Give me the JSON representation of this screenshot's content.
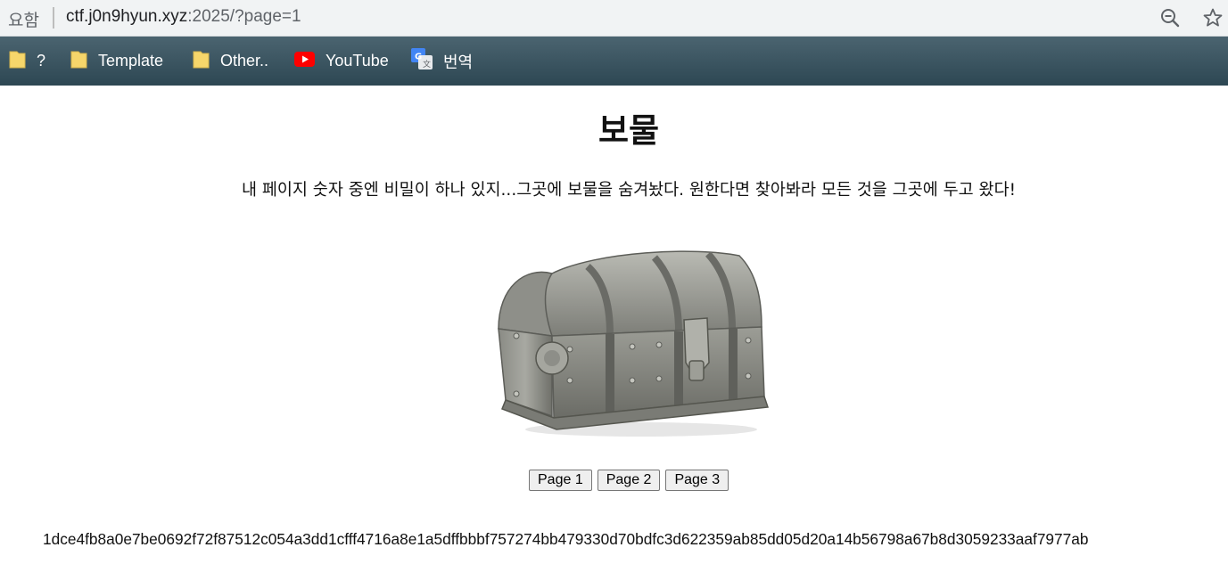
{
  "browser": {
    "site_info": "요함",
    "url_host": "ctf.j0n9hyun.xyz",
    "url_rest": ":2025/?page=1",
    "icons": [
      "zoom-out-icon",
      "star-icon"
    ]
  },
  "bookmarks": [
    {
      "label": "?",
      "icon": "folder-icon"
    },
    {
      "label": "Template",
      "icon": "folder-icon"
    },
    {
      "label": "Other..",
      "icon": "folder-icon"
    },
    {
      "label": "YouTube",
      "icon": "youtube-icon"
    },
    {
      "label": "번역",
      "icon": "google-translate-icon"
    }
  ],
  "page": {
    "title": "보물",
    "description": "내 페이지 숫자 중엔 비밀이 하나 있지...그곳에 보물을 숨겨놨다. 원한다면 찾아봐라 모든 것을 그곳에 두고 왔다!",
    "image": "treasure-chest",
    "buttons": [
      "Page 1",
      "Page 2",
      "Page 3"
    ],
    "hash": "1dce4fb8a0e7be0692f72f87512c054a3dd1cfff4716a8e1a5dffbbbf757274bb479330d70bdfc3d622359ab85dd05d20a14b56798a67b8d3059233aaf7977ab"
  },
  "colors": {
    "bookmark_bar": "#3d5662",
    "address_bar": "#f1f3f4",
    "folder": "#f6d66b",
    "youtube": "#ff0000"
  }
}
